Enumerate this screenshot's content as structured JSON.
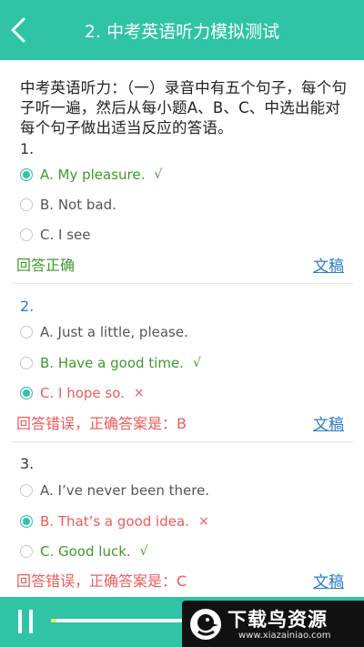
{
  "header": {
    "title": "2. 中考英语听力模拟测试"
  },
  "instructions": "中考英语听力：（一）录音中有五个句子，每个句子听一遍，然后从每小题A、B、C、中选出能对每个句子做出适当反应的答语。",
  "transcript_label": "文稿",
  "questions": [
    {
      "number": "1.",
      "options": [
        {
          "text": "A. My pleasure.",
          "mark": "√"
        },
        {
          "text": "B. Not bad.",
          "mark": ""
        },
        {
          "text": "C. I see",
          "mark": ""
        }
      ],
      "result": "回答正确"
    },
    {
      "number": "2.",
      "options": [
        {
          "text": "A. Just a little, please.",
          "mark": ""
        },
        {
          "text": "B. Have a good time.",
          "mark": "√"
        },
        {
          "text": "C. I hope so.",
          "mark": "×"
        }
      ],
      "result": "回答错误，正确答案是：B"
    },
    {
      "number": "3.",
      "options": [
        {
          "text": "A. I’ve never been there.",
          "mark": ""
        },
        {
          "text": "B. That’s a good idea.",
          "mark": "×"
        },
        {
          "text": "C. Good luck.",
          "mark": "√"
        }
      ],
      "result": "回答错误，正确答案是：C"
    }
  ],
  "player": {
    "progress": 0.04
  },
  "watermark": {
    "text": "下载鸟资源",
    "url": "www.xiazainiao.com"
  },
  "colors": {
    "accent": "#2fc4a6",
    "correct": "#3f9a2b",
    "wrong": "#f05a5a",
    "link": "#2a7ec9"
  }
}
